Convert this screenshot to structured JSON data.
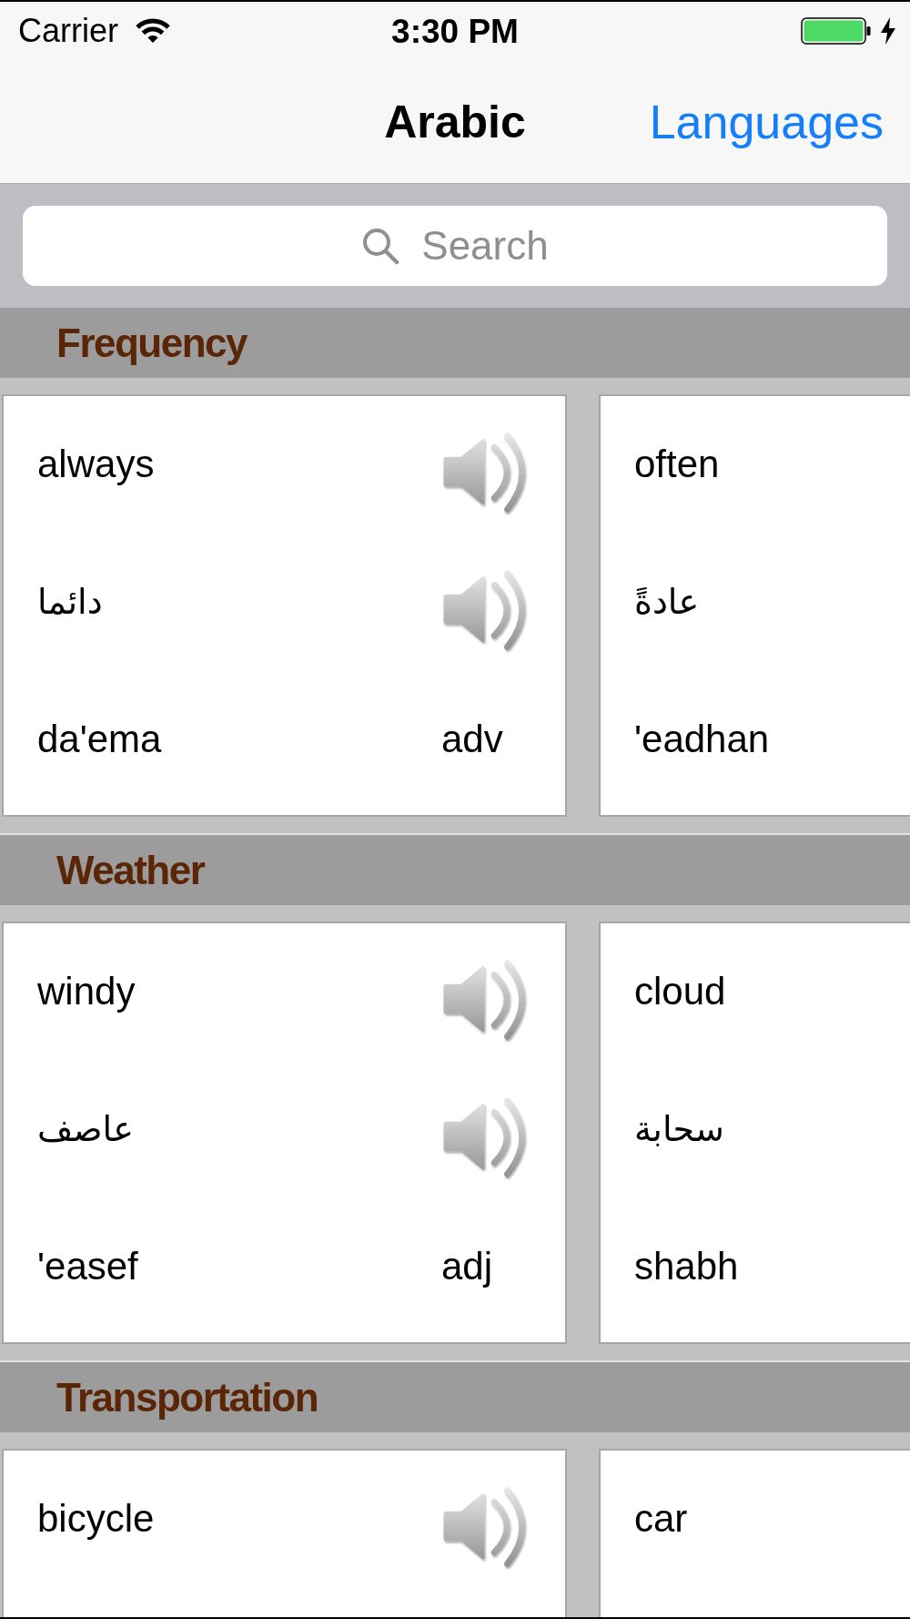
{
  "status_bar": {
    "carrier": "Carrier",
    "time": "3:30 PM",
    "charging": true
  },
  "nav_bar": {
    "title": "Arabic",
    "right_button": "Languages"
  },
  "search": {
    "placeholder": "Search"
  },
  "sections": [
    {
      "title": "Frequency",
      "cards": [
        {
          "lines": [
            {
              "kind": "english",
              "text": "always",
              "speaker": true
            },
            {
              "kind": "arabic",
              "text": "دائما",
              "speaker": true
            },
            {
              "kind": "transliteration",
              "text": "da'ema",
              "part_of_speech": "adv"
            }
          ]
        },
        {
          "lines": [
            {
              "kind": "english",
              "text": "often"
            },
            {
              "kind": "arabic",
              "text": "عادةً"
            },
            {
              "kind": "transliteration",
              "text": "'eadhan"
            }
          ]
        }
      ]
    },
    {
      "title": "Weather",
      "cards": [
        {
          "lines": [
            {
              "kind": "english",
              "text": "windy",
              "speaker": true
            },
            {
              "kind": "arabic",
              "text": "عاصف",
              "speaker": true
            },
            {
              "kind": "transliteration",
              "text": "'easef",
              "part_of_speech": "adj"
            }
          ]
        },
        {
          "lines": [
            {
              "kind": "english",
              "text": "cloud"
            },
            {
              "kind": "arabic",
              "text": "سحابة"
            },
            {
              "kind": "transliteration",
              "text": "shabh"
            }
          ]
        }
      ]
    },
    {
      "title": "Transportation",
      "cards": [
        {
          "lines": [
            {
              "kind": "english",
              "text": "bicycle",
              "speaker": true
            }
          ]
        },
        {
          "lines": [
            {
              "kind": "english",
              "text": "car"
            }
          ]
        }
      ]
    }
  ]
}
